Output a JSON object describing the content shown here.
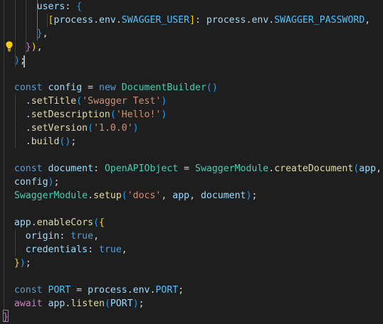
{
  "editor": {
    "colors": {
      "background": "#1e1e1e",
      "default": "#d4d4d4",
      "keyword": "#569cd6",
      "control": "#c586c0",
      "variable": "#9cdcfe",
      "constant": "#4fc1ff",
      "function": "#dcdcaa",
      "type": "#4ec9b0",
      "string": "#ce9178",
      "bracket1": "#ffd700",
      "bracket2": "#da70d6",
      "bracket3": "#179fff"
    },
    "lightbulb_icon": "lightbulb-icon",
    "lines": [
      [
        [
          "      ",
          "plain"
        ],
        [
          "users",
          "variable"
        ],
        [
          ":",
          "plain"
        ],
        [
          " ",
          "plain"
        ],
        [
          "{",
          "bracket3"
        ]
      ],
      [
        [
          "        ",
          "plain"
        ],
        [
          "[",
          "bracket1"
        ],
        [
          "process",
          "variable"
        ],
        [
          ".",
          "plain"
        ],
        [
          "env",
          "variable"
        ],
        [
          ".",
          "plain"
        ],
        [
          "SWAGGER_USER",
          "constant"
        ],
        [
          "]",
          "bracket1"
        ],
        [
          ": ",
          "plain"
        ],
        [
          "process",
          "variable"
        ],
        [
          ".",
          "plain"
        ],
        [
          "env",
          "variable"
        ],
        [
          ".",
          "plain"
        ],
        [
          "SWAGGER_PASSWORD",
          "constant"
        ],
        [
          ",",
          "plain"
        ]
      ],
      [
        [
          "      ",
          "plain"
        ],
        [
          "}",
          "bracket3"
        ],
        [
          ",",
          "plain"
        ]
      ],
      [
        [
          "    ",
          "plain"
        ],
        [
          "}",
          "bracket2"
        ],
        [
          ")",
          "bracket1"
        ],
        [
          ",",
          "plain"
        ]
      ],
      [
        [
          "  ",
          "plain"
        ],
        [
          ")",
          "bracket3"
        ],
        [
          ";",
          "plain"
        ]
      ],
      [],
      [
        [
          "  ",
          "plain"
        ],
        [
          "const",
          "keyword"
        ],
        [
          " ",
          "plain"
        ],
        [
          "config",
          "variable"
        ],
        [
          " = ",
          "plain"
        ],
        [
          "new",
          "keyword"
        ],
        [
          " ",
          "plain"
        ],
        [
          "DocumentBuilder",
          "type"
        ],
        [
          "(",
          "bracket3"
        ],
        [
          ")",
          "bracket3"
        ]
      ],
      [
        [
          "    ",
          "plain"
        ],
        [
          ".",
          "plain"
        ],
        [
          "setTitle",
          "function"
        ],
        [
          "(",
          "bracket3"
        ],
        [
          "'Swagger Test'",
          "string"
        ],
        [
          ")",
          "bracket3"
        ]
      ],
      [
        [
          "    ",
          "plain"
        ],
        [
          ".",
          "plain"
        ],
        [
          "setDescription",
          "function"
        ],
        [
          "(",
          "bracket3"
        ],
        [
          "'Hello!'",
          "string"
        ],
        [
          ")",
          "bracket3"
        ]
      ],
      [
        [
          "    ",
          "plain"
        ],
        [
          ".",
          "plain"
        ],
        [
          "setVersion",
          "function"
        ],
        [
          "(",
          "bracket3"
        ],
        [
          "'1.0.0'",
          "string"
        ],
        [
          ")",
          "bracket3"
        ]
      ],
      [
        [
          "    ",
          "plain"
        ],
        [
          ".",
          "plain"
        ],
        [
          "build",
          "function"
        ],
        [
          "(",
          "bracket3"
        ],
        [
          ")",
          "bracket3"
        ],
        [
          ";",
          "plain"
        ]
      ],
      [],
      [
        [
          "  ",
          "plain"
        ],
        [
          "const",
          "keyword"
        ],
        [
          " ",
          "plain"
        ],
        [
          "document",
          "variable"
        ],
        [
          ": ",
          "plain"
        ],
        [
          "OpenAPIObject",
          "type"
        ],
        [
          " = ",
          "plain"
        ],
        [
          "SwaggerModule",
          "type"
        ],
        [
          ".",
          "plain"
        ],
        [
          "createDocument",
          "function"
        ],
        [
          "(",
          "bracket3"
        ],
        [
          "app",
          "variable"
        ],
        [
          ",",
          "plain"
        ]
      ],
      [
        [
          "  ",
          "plain"
        ],
        [
          "config",
          "variable"
        ],
        [
          ")",
          "bracket3"
        ],
        [
          ";",
          "plain"
        ]
      ],
      [
        [
          "  ",
          "plain"
        ],
        [
          "SwaggerModule",
          "type"
        ],
        [
          ".",
          "plain"
        ],
        [
          "setup",
          "function"
        ],
        [
          "(",
          "bracket3"
        ],
        [
          "'docs'",
          "string"
        ],
        [
          ", ",
          "plain"
        ],
        [
          "app",
          "variable"
        ],
        [
          ", ",
          "plain"
        ],
        [
          "document",
          "variable"
        ],
        [
          ")",
          "bracket3"
        ],
        [
          ";",
          "plain"
        ]
      ],
      [],
      [
        [
          "  ",
          "plain"
        ],
        [
          "app",
          "variable"
        ],
        [
          ".",
          "plain"
        ],
        [
          "enableCors",
          "function"
        ],
        [
          "(",
          "bracket3"
        ],
        [
          "{",
          "bracket1"
        ]
      ],
      [
        [
          "    ",
          "plain"
        ],
        [
          "origin",
          "variable"
        ],
        [
          ": ",
          "plain"
        ],
        [
          "true",
          "keyword"
        ],
        [
          ",",
          "plain"
        ]
      ],
      [
        [
          "    ",
          "plain"
        ],
        [
          "credentials",
          "variable"
        ],
        [
          ": ",
          "plain"
        ],
        [
          "true",
          "keyword"
        ],
        [
          ",",
          "plain"
        ]
      ],
      [
        [
          "  ",
          "plain"
        ],
        [
          "}",
          "bracket1"
        ],
        [
          ")",
          "bracket3"
        ],
        [
          ";",
          "plain"
        ]
      ],
      [],
      [
        [
          "  ",
          "plain"
        ],
        [
          "const",
          "keyword"
        ],
        [
          " ",
          "plain"
        ],
        [
          "PORT",
          "constant"
        ],
        [
          " = ",
          "plain"
        ],
        [
          "process",
          "variable"
        ],
        [
          ".",
          "plain"
        ],
        [
          "env",
          "variable"
        ],
        [
          ".",
          "plain"
        ],
        [
          "PORT",
          "constant"
        ],
        [
          ";",
          "plain"
        ]
      ],
      [
        [
          "  ",
          "plain"
        ],
        [
          "await",
          "control"
        ],
        [
          " ",
          "plain"
        ],
        [
          "app",
          "variable"
        ],
        [
          ".",
          "plain"
        ],
        [
          "listen",
          "function"
        ],
        [
          "(",
          "bracket3"
        ],
        [
          "PORT",
          "variable"
        ],
        [
          ")",
          "bracket3"
        ],
        [
          ";",
          "plain"
        ]
      ],
      [
        [
          "}",
          "bracket2"
        ]
      ]
    ]
  }
}
